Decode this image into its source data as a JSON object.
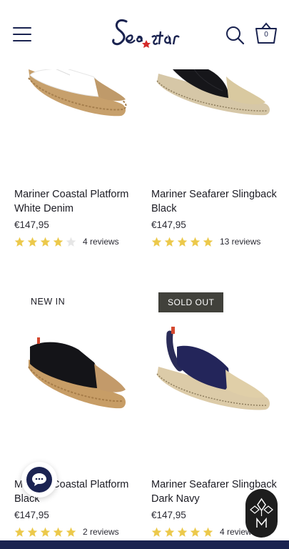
{
  "header": {
    "brand": "Sea star",
    "cart_count": "0"
  },
  "products": [
    {
      "title": "Mariner Coastal Platform White Denim",
      "price": "€147,95",
      "rating": 4,
      "reviews": "4 reviews"
    },
    {
      "title": "Mariner Seafarer Slingback Black",
      "price": "€147,95",
      "rating": 5,
      "reviews": "13 reviews"
    },
    {
      "badge": "NEW IN",
      "title": "Mariner Coastal Platform Black",
      "price": "€147,95",
      "rating": 5,
      "reviews": "2 reviews"
    },
    {
      "badge": "SOLD OUT",
      "title": "Mariner Seafarer Slingback Dark Navy",
      "price": "€147,95",
      "rating": 5,
      "reviews": "4 reviews"
    }
  ],
  "icons": {
    "menu": "hamburger-menu-icon",
    "search": "search-icon",
    "cart": "cart-basket-icon",
    "chat": "chat-bubble-icon",
    "widget": "m-logo-icon"
  },
  "colors": {
    "brand_navy": "#1a2350",
    "star_gold": "#ecc94b",
    "star_empty": "#e6e6e6",
    "sold_out_bg": "#41413b"
  }
}
